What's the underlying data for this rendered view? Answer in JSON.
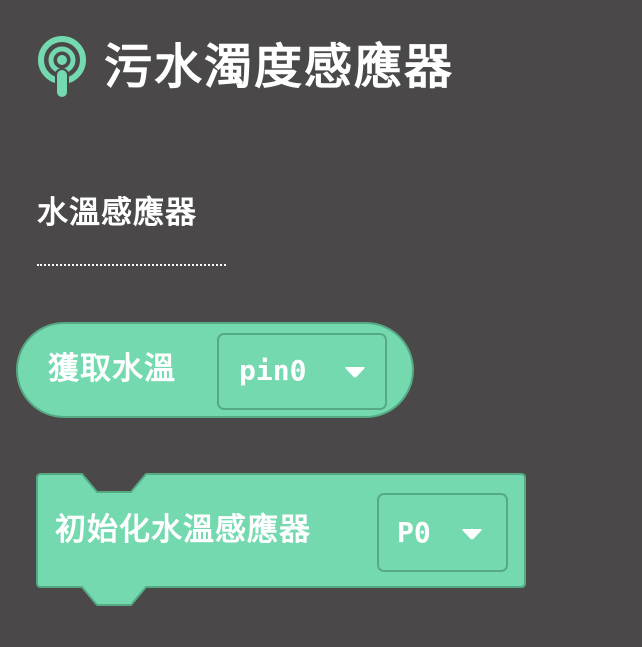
{
  "category": {
    "title": "污水濁度感應器",
    "icon": "broadcast-sensor-icon",
    "color": "#75d9b0"
  },
  "section": {
    "label": "水溫感應器"
  },
  "blocks": {
    "get_temperature": {
      "label": "獲取水溫",
      "pin_value": "pin0",
      "arrow_icon": "dropdown-arrow-icon"
    },
    "init_sensor": {
      "label": "初始化水溫感應器",
      "pin_value": "P0",
      "arrow_icon": "dropdown-arrow-icon"
    }
  },
  "colors": {
    "background": "#4a4849",
    "block_fill": "#75d9b0",
    "block_border": "#56aa83",
    "text": "#ffffff"
  }
}
